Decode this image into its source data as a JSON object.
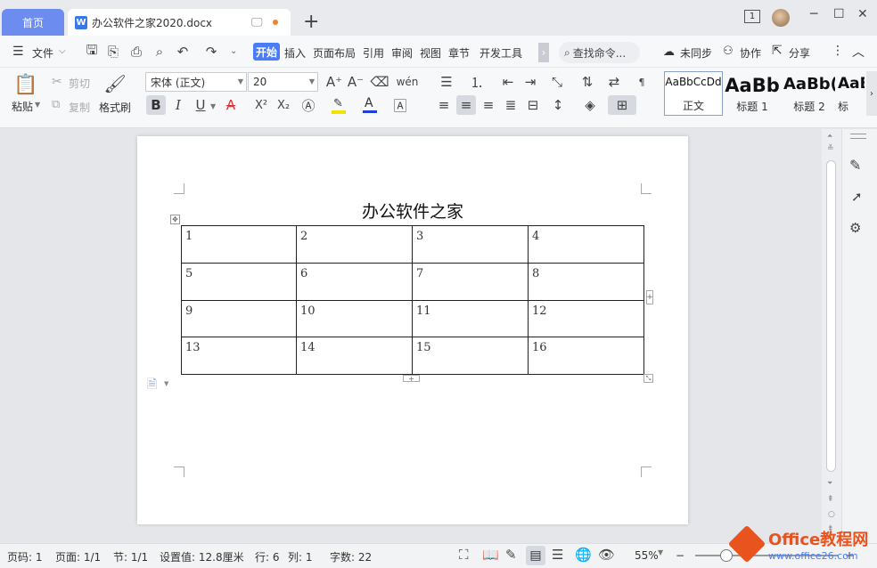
{
  "tabs": {
    "home": "首页",
    "document": "办公软件之家2020.docx",
    "new_tab": "+"
  },
  "window": {
    "badge": "1",
    "minimize": "─",
    "maximize": "☐",
    "close": "✕"
  },
  "menu": {
    "file": "文件",
    "items": [
      "开始",
      "插入",
      "页面布局",
      "引用",
      "审阅",
      "视图",
      "章节",
      "开发工具"
    ],
    "more": "›",
    "search": "查找命令...",
    "sync": "未同步",
    "collab": "协作",
    "share": "分享"
  },
  "ribbon": {
    "paste": "粘贴",
    "cut": "剪切",
    "copy": "复制",
    "format_painter": "格式刷",
    "font_name": "宋体 (正文)",
    "font_size": "20",
    "bold": "B",
    "italic": "I",
    "underline": "U",
    "strike": "A",
    "superscript": "X²",
    "subscript": "X₂",
    "font_color": "A"
  },
  "styles": [
    {
      "preview": "AaBbCcDd",
      "label": "正文"
    },
    {
      "preview": "AaBb",
      "label": "标题 1"
    },
    {
      "preview": "AaBb(",
      "label": "标题 2"
    },
    {
      "preview": "AaBl",
      "label": "标"
    }
  ],
  "document": {
    "title": "办公软件之家",
    "table": [
      [
        "1",
        "2",
        "3",
        "4"
      ],
      [
        "5",
        "6",
        "7",
        "8"
      ],
      [
        "9",
        "10",
        "11",
        "12"
      ],
      [
        "13",
        "14",
        "15",
        "16"
      ]
    ]
  },
  "status": {
    "page": "页码: 1",
    "pages": "页面: 1/1",
    "section": "节: 1/1",
    "setting": "设置值: 12.8厘米",
    "row": "行: 6",
    "col": "列: 1",
    "words": "字数: 22",
    "zoom": "55%",
    "zoom_minus": "−",
    "zoom_plus": "+"
  },
  "watermark": {
    "brand": "Office教程网",
    "url": "www.office26.com"
  },
  "colors": {
    "accent": "#4a7cf7",
    "home_tab": "#6d8cf0",
    "watermark": "#e9541e"
  }
}
